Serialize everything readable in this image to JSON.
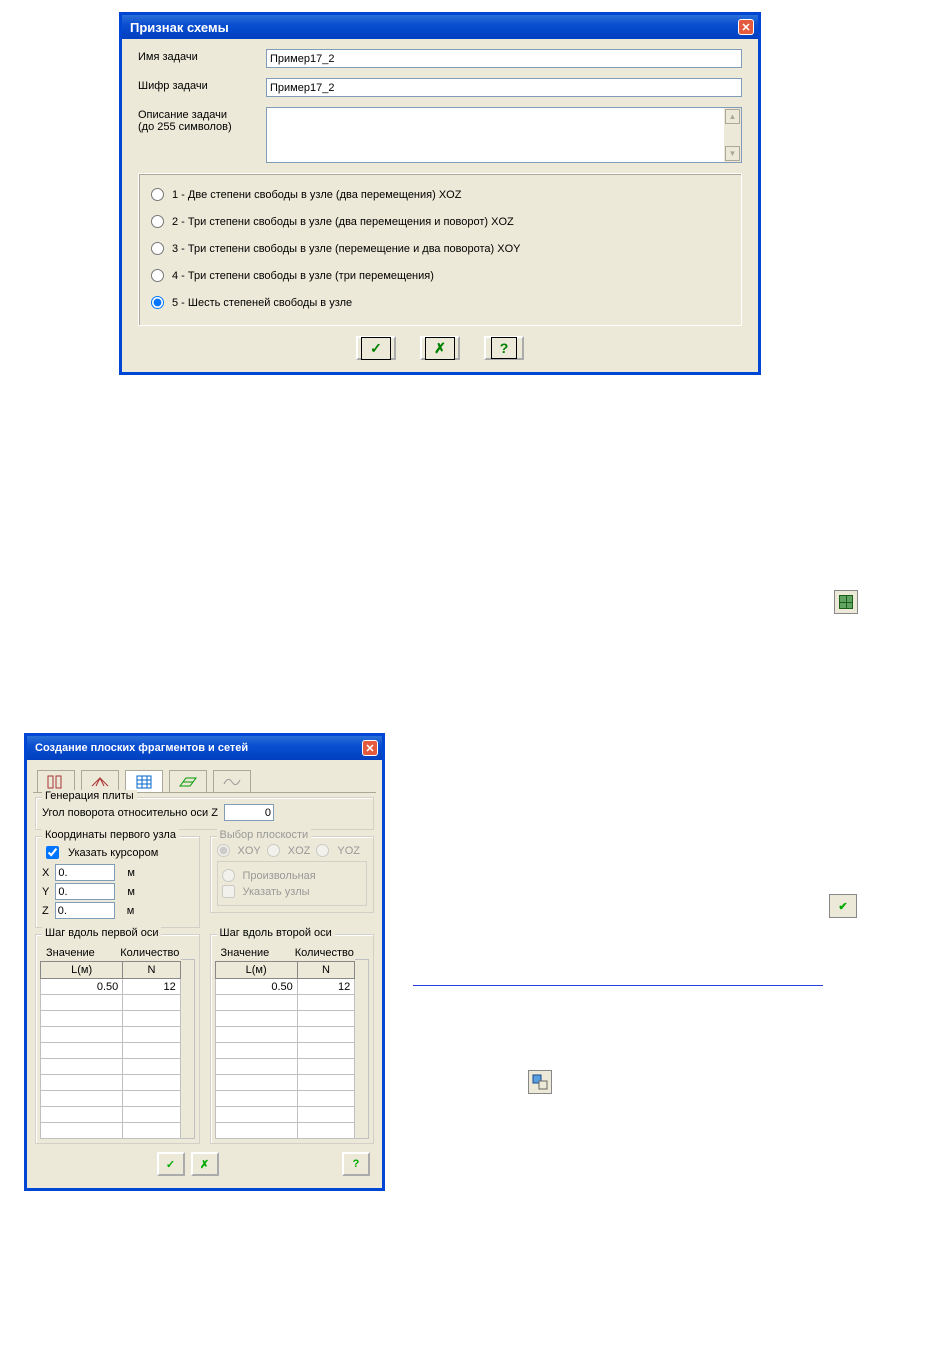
{
  "dialog1": {
    "title": "Признак схемы",
    "fields": {
      "name_label": "Имя задачи",
      "name_value": "Пример17_2",
      "code_label": "Шифр задачи",
      "code_value": "Пример17_2",
      "desc_line1": "Описание задачи",
      "desc_line2": "(до 255 символов)",
      "desc_value": ""
    },
    "radios": [
      "1 - Две степени свободы в узле (два перемещения) XOZ",
      "2 - Три степени свободы в узле (два перемещения и поворот) XOZ",
      "3 - Три степени свободы в узле (перемещение и два поворота) XOY",
      "4 - Три степени свободы в узле (три перемещения)",
      "5 - Шесть степеней свободы в узле"
    ],
    "selected_radio": 4
  },
  "icons": {
    "ok": "✓",
    "cancel": "✗",
    "help": "?"
  },
  "dialog2": {
    "title": "Создание плоских фрагментов и сетей",
    "gen_legend": "Генерация плиты",
    "angle_label": "Угол поворота относительно оси Z",
    "angle_value": "0",
    "coords_legend": "Координаты первого узла",
    "cursor_label": "Указать курсором",
    "cursor_checked": true,
    "coords": {
      "x_label": "X",
      "x_value": "0.",
      "x_unit": "м",
      "y_label": "Y",
      "y_value": "0.",
      "y_unit": "м",
      "z_label": "Z",
      "z_value": "0.",
      "z_unit": "м"
    },
    "plane_legend": "Выбор плоскости",
    "plane_opts": [
      "XOY",
      "XOZ",
      "YOZ"
    ],
    "plane_arbitrary": "Произвольная",
    "plane_nodes": "Указать узлы",
    "axis1": {
      "legend": "Шаг вдоль первой оси",
      "c1": "Значение",
      "c2": "Количество",
      "h1": "L(м)",
      "h2": "N",
      "l": "0.50",
      "n": "12"
    },
    "axis2": {
      "legend": "Шаг вдоль второй оси",
      "c1": "Значение",
      "c2": "Количество",
      "h1": "L(м)",
      "h2": "N",
      "l": "0.50",
      "n": "12"
    }
  }
}
